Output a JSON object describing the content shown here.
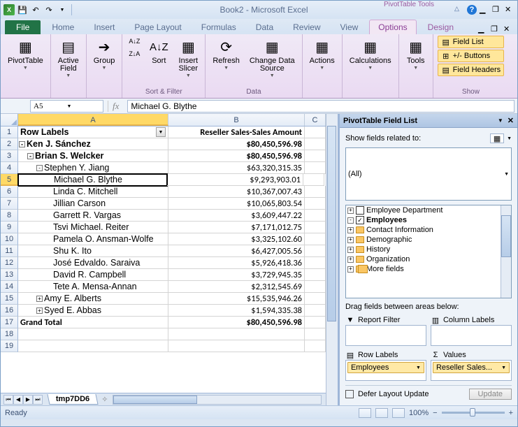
{
  "title": "Book2 - Microsoft Excel",
  "contextual_title": "PivotTable Tools",
  "ribbon_tabs": [
    "File",
    "Home",
    "Insert",
    "Page Layout",
    "Formulas",
    "Data",
    "Review",
    "View",
    "Options",
    "Design"
  ],
  "ribbon": {
    "pivottable": "PivotTable",
    "activefield": "Active\nField",
    "group_btn": "Group",
    "sort": "Sort",
    "slicer": "Insert\nSlicer",
    "refresh": "Refresh",
    "changedata": "Change Data\nSource",
    "actions": "Actions",
    "calculations": "Calculations",
    "tools": "Tools",
    "fieldlist": "Field List",
    "plusminus": "+/- Buttons",
    "fieldheaders": "Field Headers",
    "group_sortfilter": "Sort & Filter",
    "group_data": "Data",
    "group_show": "Show"
  },
  "name_box": "A5",
  "formula_value": "Michael G. Blythe",
  "columns": [
    "A",
    "B",
    "C"
  ],
  "header_a": "Row Labels",
  "header_b": "Reseller Sales-Sales Amount",
  "rows": [
    {
      "exp": "-",
      "ind": 0,
      "a": "Ken J. Sánchez",
      "b": "$80,450,596.98",
      "bold": true
    },
    {
      "exp": "-",
      "ind": 1,
      "a": "Brian S. Welcker",
      "b": "$80,450,596.98",
      "bold": true
    },
    {
      "exp": "-",
      "ind": 2,
      "a": "Stephen Y. Jiang",
      "b": "$63,320,315.35"
    },
    {
      "exp": "",
      "ind": 3,
      "a": "Michael G. Blythe",
      "b": "$9,293,903.01",
      "sel": true
    },
    {
      "exp": "",
      "ind": 3,
      "a": "Linda C. Mitchell",
      "b": "$10,367,007.43"
    },
    {
      "exp": "",
      "ind": 3,
      "a": "Jillian Carson",
      "b": "$10,065,803.54"
    },
    {
      "exp": "",
      "ind": 3,
      "a": "Garrett R. Vargas",
      "b": "$3,609,447.22"
    },
    {
      "exp": "",
      "ind": 3,
      "a": "Tsvi Michael. Reiter",
      "b": "$7,171,012.75"
    },
    {
      "exp": "",
      "ind": 3,
      "a": "Pamela O. Ansman-Wolfe",
      "b": "$3,325,102.60"
    },
    {
      "exp": "",
      "ind": 3,
      "a": "Shu K. Ito",
      "b": "$6,427,005.56"
    },
    {
      "exp": "",
      "ind": 3,
      "a": "José Edvaldo. Saraiva",
      "b": "$5,926,418.36"
    },
    {
      "exp": "",
      "ind": 3,
      "a": "David R. Campbell",
      "b": "$3,729,945.35"
    },
    {
      "exp": "",
      "ind": 3,
      "a": "Tete A. Mensa-Annan",
      "b": "$2,312,545.69"
    },
    {
      "exp": "+",
      "ind": 2,
      "a": "Amy E. Alberts",
      "b": "$15,535,946.26"
    },
    {
      "exp": "+",
      "ind": 2,
      "a": "Syed E. Abbas",
      "b": "$1,594,335.38"
    }
  ],
  "grand_total_label": "Grand Total",
  "grand_total_value": "$80,450,596.98",
  "sheet_tab": "tmp7DD6",
  "status_ready": "Ready",
  "zoom": "100%",
  "taskpane": {
    "title": "PivotTable Field List",
    "show_related": "Show fields related to:",
    "related_value": "(All)",
    "fields": [
      {
        "exp": "+",
        "type": "check",
        "checked": false,
        "label": "Employee Department"
      },
      {
        "exp": "-",
        "type": "check",
        "checked": true,
        "label": "Employees",
        "bold": true
      },
      {
        "exp": "+",
        "type": "folder",
        "label": "Contact Information"
      },
      {
        "exp": "+",
        "type": "folder",
        "label": "Demographic"
      },
      {
        "exp": "+",
        "type": "folder",
        "label": "History"
      },
      {
        "exp": "+",
        "type": "folder",
        "label": "Organization"
      },
      {
        "exp": "+",
        "type": "multi",
        "label": "More fields"
      }
    ],
    "drag_label": "Drag fields between areas below:",
    "report_filter": "Report Filter",
    "column_labels": "Column Labels",
    "row_labels": "Row Labels",
    "values_label": "Values",
    "row_chip": "Employees",
    "values_chip": "Reseller Sales...",
    "defer": "Defer Layout Update",
    "update": "Update"
  }
}
